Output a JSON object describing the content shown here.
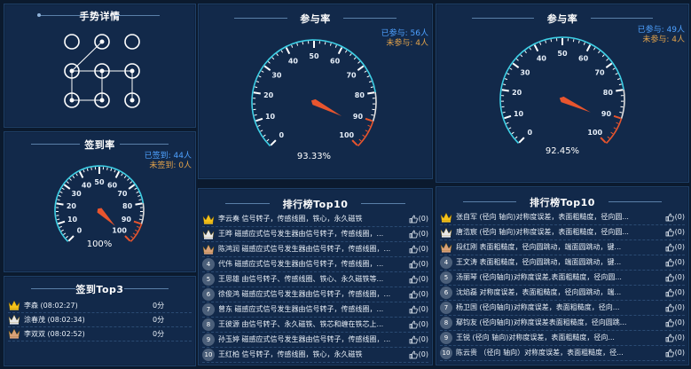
{
  "gesture": {
    "title": "手势详情"
  },
  "sign": {
    "title": "签到率",
    "signed": "已签到: 44人",
    "unsigned": "未签到: 0人",
    "percent": "100%",
    "value": 100,
    "ticks": [
      "0",
      "10",
      "20",
      "30",
      "40",
      "50",
      "60",
      "70",
      "80",
      "90",
      "100"
    ]
  },
  "top3": {
    "title": "签到Top3",
    "rows": [
      {
        "name": "李森 (08:02:27)",
        "score": "0分"
      },
      {
        "name": "涂春茂 (08:02:34)",
        "score": "0分"
      },
      {
        "name": "李双双 (08:02:52)",
        "score": "0分"
      }
    ]
  },
  "part1": {
    "title": "参与率",
    "joined": "已参与: 56人",
    "notjoined": "未参与: 4人",
    "percent": "93.33%",
    "value": 93.33,
    "ticks": [
      "0",
      "10",
      "20",
      "30",
      "40",
      "50",
      "60",
      "70",
      "80",
      "90",
      "100"
    ]
  },
  "part2": {
    "title": "参与率",
    "joined": "已参与: 49人",
    "notjoined": "未参与: 4人",
    "percent": "92.45%",
    "value": 92.45,
    "ticks": [
      "0",
      "10",
      "20",
      "30",
      "40",
      "50",
      "60",
      "70",
      "80",
      "90",
      "100"
    ]
  },
  "rank1": {
    "title": "排行榜Top10",
    "rows": [
      {
        "text": "李云奏 信号转子，传感线圈，铁心，永久磁铁",
        "likes": "(0)"
      },
      {
        "text": "王晔 磁感应式信号发生器由信号转子，传感线圈，...",
        "likes": "(0)"
      },
      {
        "text": "陈鸿润 磁感应式信号发生器由信号转子，传感线圈，...",
        "likes": "(0)"
      },
      {
        "text": "代伟 磁感应式信号发生器由信号转子，传感线圈，...",
        "likes": "(0)"
      },
      {
        "text": "王思雄 由信号转子、传感线圈、铁心、永久磁铁等...",
        "likes": "(0)"
      },
      {
        "text": "徐俊鸿 磁感应式信号发生器由信号转子，传感线圈，...",
        "likes": "(0)"
      },
      {
        "text": "曾东 磁感应式信号发生器由信号转子，传感线圈，...",
        "likes": "(0)"
      },
      {
        "text": "王彼源 由信号转子、永久磁铁、铁芯和缠在铁芯上...",
        "likes": "(0)"
      },
      {
        "text": "孙玉婷 磁感应式信号发生器由信号转子，传感线圈，...",
        "likes": "(0)"
      },
      {
        "text": "王红柏 信号转子，传感线圈，铁心，永久磁铁",
        "likes": "(0)"
      }
    ]
  },
  "rank2": {
    "title": "排行榜Top10",
    "rows": [
      {
        "text": "张自军 (径向 轴向)对称度误差，表面粗糙度，径向圆...",
        "likes": "(0)"
      },
      {
        "text": "唐浩宸 (径向 轴向)对称度误差，表面粗糙度，径向圆...",
        "likes": "(0)"
      },
      {
        "text": "段红刚 表面粗糙度，径向圆跳动，端面圆跳动，键...",
        "likes": "(0)"
      },
      {
        "text": "王文涛 表面粗糙度，径向圆跳动，端面圆跳动，键...",
        "likes": "(0)"
      },
      {
        "text": "汤丽琴 (径向轴向)对称度误差,表面粗糙度，径向圆...",
        "likes": "(0)"
      },
      {
        "text": "沈焰磊 对称度误差，表面粗糙度，径向圆跳动，端...",
        "likes": "(0)"
      },
      {
        "text": "杨卫国 (径向轴向)对称度误差，表面粗糙度，径向...",
        "likes": "(0)"
      },
      {
        "text": "鄢钧友 (径向轴向)对称度误差表面粗糙度，径向圆跳...",
        "likes": "(0)"
      },
      {
        "text": "王锐 (径向 轴向)对称度误差，表面粗糙度，径向...",
        "likes": "(0)"
      },
      {
        "text": "陈云贵 （径向 轴向）对称度误差，表面粗糙度，径...",
        "likes": "(0)"
      }
    ]
  },
  "colors": {
    "gold": "#f5c21a",
    "silver": "#e8e8e8",
    "bronze": "#d9a179",
    "needle": "#e8552e",
    "accent": "#3ed0e6",
    "badge": "#4b5f7a"
  }
}
